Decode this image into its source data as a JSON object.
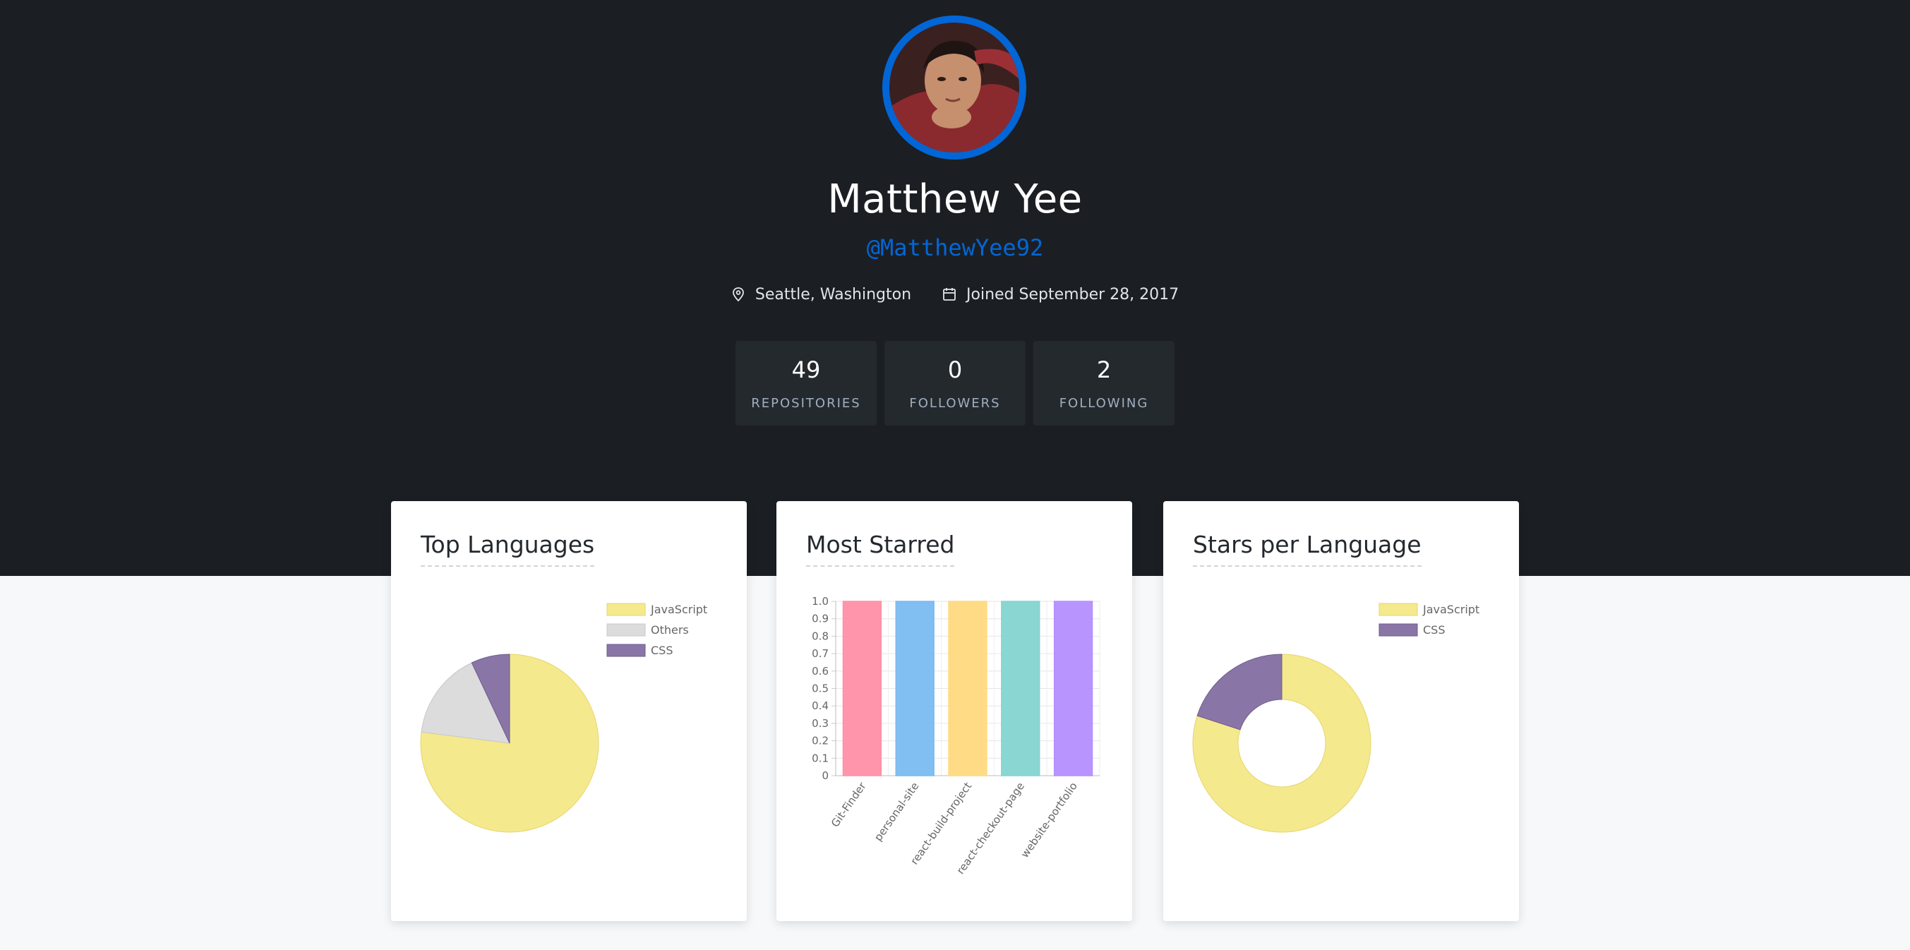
{
  "profile": {
    "name": "Matthew Yee",
    "login": "@MatthewYee92",
    "location": "Seattle, Washington",
    "joined": "Joined September 28, 2017",
    "avatar_icon": "user-photo"
  },
  "stats": [
    {
      "value": "49",
      "label": "Repositories"
    },
    {
      "value": "0",
      "label": "Followers"
    },
    {
      "value": "2",
      "label": "Following"
    }
  ],
  "colors": {
    "accent": "#0366d6",
    "hero_bg": "#1b1f23",
    "page_bg": "#f6f8fa"
  },
  "cards": {
    "top_languages": {
      "title": "Top Languages"
    },
    "most_starred": {
      "title": "Most Starred"
    },
    "stars_per_language": {
      "title": "Stars per Language"
    }
  },
  "chart_data": [
    {
      "type": "pie",
      "title": "Top Languages",
      "labels": [
        "JavaScript",
        "Others",
        "CSS"
      ],
      "values": [
        77,
        16,
        7
      ],
      "colors": [
        "#f5e98e",
        "#dcdcdc",
        "#8a76a6"
      ],
      "legend": "top-right"
    },
    {
      "type": "bar",
      "title": "Most Starred",
      "categories": [
        "Git-Finder",
        "personal-site",
        "react-build-project",
        "react-checkout-page",
        "website-portfolio"
      ],
      "values": [
        1,
        1,
        1,
        1,
        1
      ],
      "colors": [
        "#ff8fa6",
        "#7abaf0",
        "#ffd980",
        "#84d4d0",
        "#b48eff"
      ],
      "ylim": [
        0,
        1
      ],
      "yticks": [
        "0",
        "0.1",
        "0.2",
        "0.3",
        "0.4",
        "0.5",
        "0.6",
        "0.7",
        "0.8",
        "0.9",
        "1.0"
      ],
      "grid": true
    },
    {
      "type": "pie",
      "title": "Stars per Language",
      "labels": [
        "JavaScript",
        "CSS"
      ],
      "values": [
        80,
        20
      ],
      "colors": [
        "#f5e98e",
        "#8a76a6"
      ],
      "legend": "top-right"
    }
  ]
}
